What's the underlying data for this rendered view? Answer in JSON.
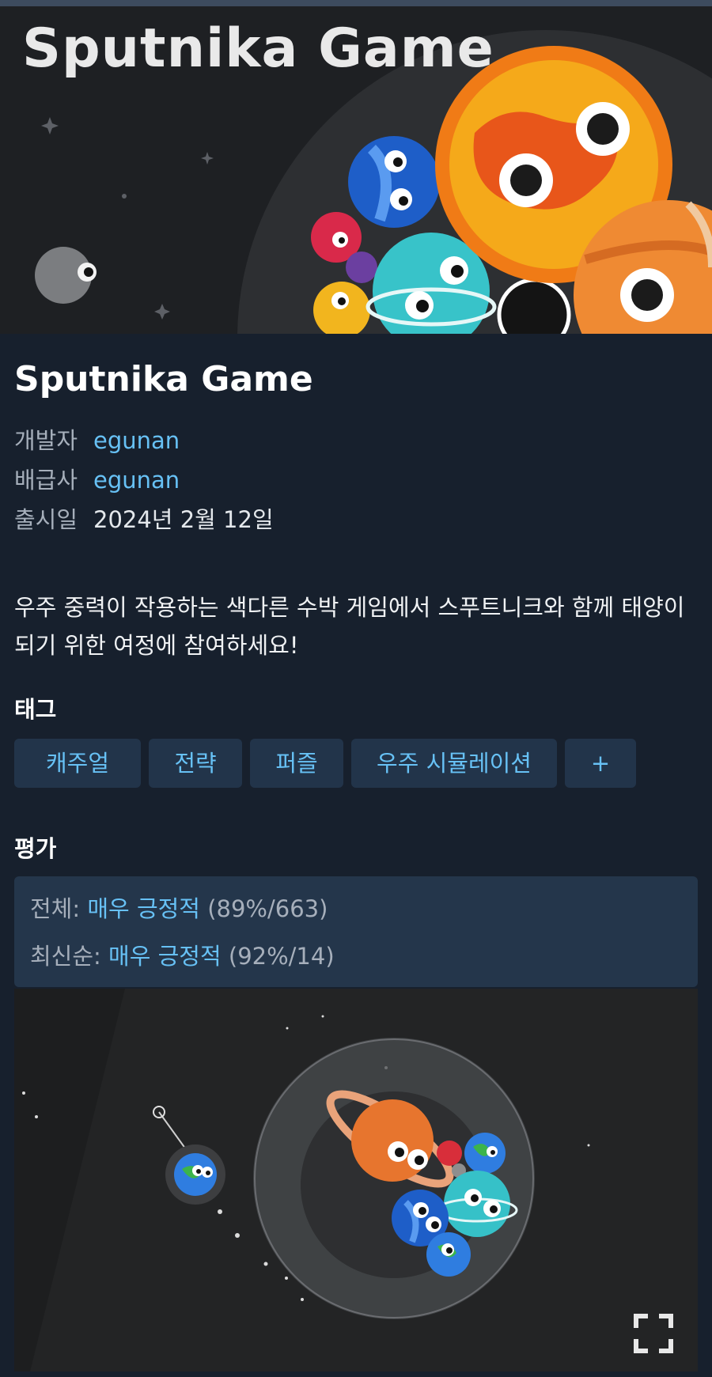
{
  "hero": {
    "banner_text": "Sputnika Game"
  },
  "game": {
    "title": "Sputnika Game",
    "developer_label": "개발자",
    "developer": "egunan",
    "publisher_label": "배급사",
    "publisher": "egunan",
    "release_label": "출시일",
    "release_date": "2024년 2월 12일",
    "description": "우주 중력이 작용하는 색다른 수박 게임에서 스푸트니크와 함께 태양이 되기 위한 여정에 참여하세요!"
  },
  "tags": {
    "heading": "태그",
    "items": [
      "캐주얼",
      "전략",
      "퍼즐",
      "우주 시뮬레이션",
      "+"
    ]
  },
  "reviews": {
    "heading": "평가",
    "overall_label": "전체:",
    "overall_rating": "매우 긍정적",
    "overall_detail": "(89%/663)",
    "recent_label": "최신순:",
    "recent_rating": "매우 긍정적",
    "recent_detail": "(92%/14)"
  },
  "colors": {
    "background": "#17202d",
    "link": "#67c1f5",
    "tag_bg": "#22344a",
    "review_bg": "#24364b"
  },
  "icons": [
    "fullscreen-icon"
  ]
}
